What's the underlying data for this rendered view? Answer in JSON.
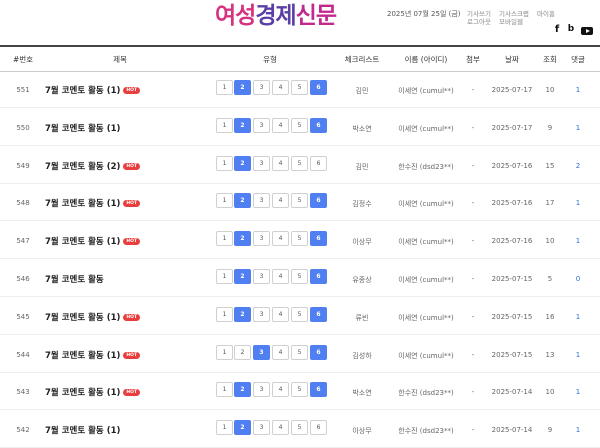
{
  "header": {
    "logo": {
      "part1": "여성",
      "part2": "경제",
      "part3": "신문"
    },
    "date": "2025년 07월 25일 (금)",
    "links_row1": [
      "기사쓰기",
      "기사스크랩",
      "마이홈"
    ],
    "links_row2": [
      "로그아웃",
      "모바일웹"
    ],
    "sns": {
      "facebook": "f",
      "blog": "b"
    }
  },
  "columns": [
    "#번호",
    "제목",
    "유형",
    "체크리스트",
    "이름 (아이디)",
    "첨부",
    "날짜",
    "조회",
    "댓글"
  ],
  "pages": [
    "1",
    "2",
    "3",
    "4",
    "5",
    "6"
  ],
  "hot_label": "HOT",
  "rows": [
    {
      "num": "551",
      "title": "7월 코멘토 활동 (1)",
      "hot": true,
      "active": [
        "2",
        "6"
      ],
      "check": "김민",
      "name": "이세연 (cumul**)",
      "file": "-",
      "date": "2025-07-17",
      "views": "10",
      "comments": "1"
    },
    {
      "num": "550",
      "title": "7월 코멘토 활동 (1)",
      "hot": false,
      "active": [
        "2",
        "6"
      ],
      "check": "박소연",
      "name": "이세연 (cumul**)",
      "file": "-",
      "date": "2025-07-17",
      "views": "9",
      "comments": "1"
    },
    {
      "num": "549",
      "title": "7월 코멘토 활동 (2)",
      "hot": true,
      "active": [
        "2"
      ],
      "check": "김민",
      "name": "한수진 (dsd23**)",
      "file": "-",
      "date": "2025-07-16",
      "views": "15",
      "comments": "2"
    },
    {
      "num": "548",
      "title": "7월 코멘토 활동 (1)",
      "hot": true,
      "active": [
        "2",
        "6"
      ],
      "check": "김정수",
      "name": "이세연 (cumul**)",
      "file": "-",
      "date": "2025-07-16",
      "views": "17",
      "comments": "1"
    },
    {
      "num": "547",
      "title": "7월 코멘토 활동 (1)",
      "hot": true,
      "active": [
        "2",
        "6"
      ],
      "check": "이상무",
      "name": "이세연 (cumul**)",
      "file": "-",
      "date": "2025-07-16",
      "views": "10",
      "comments": "1"
    },
    {
      "num": "546",
      "title": "7월 코멘토 활동",
      "hot": false,
      "active": [
        "2",
        "6"
      ],
      "check": "유종상",
      "name": "이세연 (cumul**)",
      "file": "-",
      "date": "2025-07-15",
      "views": "5",
      "comments": "0"
    },
    {
      "num": "545",
      "title": "7월 코멘토 활동 (1)",
      "hot": true,
      "active": [
        "2",
        "6"
      ],
      "check": "류빈",
      "name": "이세연 (cumul**)",
      "file": "-",
      "date": "2025-07-15",
      "views": "16",
      "comments": "1"
    },
    {
      "num": "544",
      "title": "7월 코멘토 활동 (1)",
      "hot": true,
      "active": [
        "3",
        "6"
      ],
      "check": "김성하",
      "name": "이세연 (cumul**)",
      "file": "-",
      "date": "2025-07-15",
      "views": "13",
      "comments": "1"
    },
    {
      "num": "543",
      "title": "7월 코멘토 활동 (1)",
      "hot": true,
      "active": [
        "2",
        "6"
      ],
      "check": "박소연",
      "name": "한수진 (dsd23**)",
      "file": "-",
      "date": "2025-07-14",
      "views": "10",
      "comments": "1"
    },
    {
      "num": "542",
      "title": "7월 코멘토 활동 (1)",
      "hot": false,
      "active": [
        "2"
      ],
      "check": "이상무",
      "name": "한수진 (dsd23**)",
      "file": "-",
      "date": "2025-07-14",
      "views": "9",
      "comments": "1"
    }
  ]
}
